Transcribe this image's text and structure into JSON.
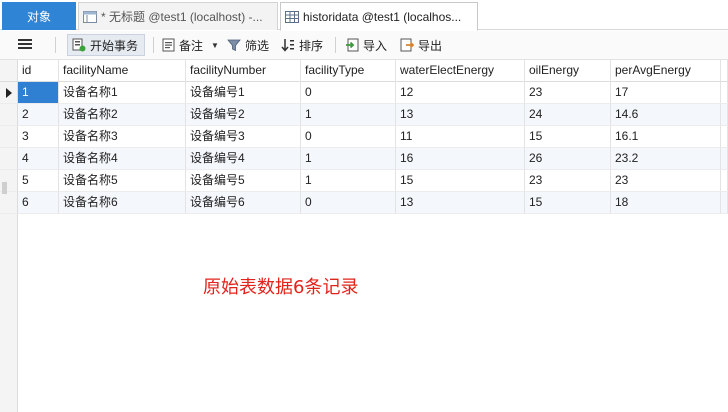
{
  "tabs": {
    "objects": "对象",
    "query": "* 无标题 @test1 (localhost) -...",
    "table": "historidata @test1 (localhos..."
  },
  "toolbar": {
    "begin_transaction": "开始事务",
    "note": "备注",
    "filter": "筛选",
    "sort": "排序",
    "import": "导入",
    "export": "导出"
  },
  "table": {
    "columns": [
      "id",
      "facilityName",
      "facilityNumber",
      "facilityType",
      "waterElectEnergy",
      "oilEnergy",
      "perAvgEnergy"
    ],
    "rows": [
      [
        "1",
        "设备名称1",
        "设备编号1",
        "0",
        "12",
        "23",
        "17"
      ],
      [
        "2",
        "设备名称2",
        "设备编号2",
        "1",
        "13",
        "24",
        "14.6"
      ],
      [
        "3",
        "设备名称3",
        "设备编号3",
        "0",
        "11",
        "15",
        "16.1"
      ],
      [
        "4",
        "设备名称4",
        "设备编号4",
        "1",
        "16",
        "26",
        "23.2"
      ],
      [
        "5",
        "设备名称5",
        "设备编号5",
        "1",
        "15",
        "23",
        "23"
      ],
      [
        "6",
        "设备名称6",
        "设备编号6",
        "0",
        "13",
        "15",
        "18"
      ]
    ]
  },
  "annotation": "原始表数据6条记录",
  "colors": {
    "accent": "#2f84d6",
    "selection": "#2f7fd3",
    "annotation": "#e3221b"
  }
}
